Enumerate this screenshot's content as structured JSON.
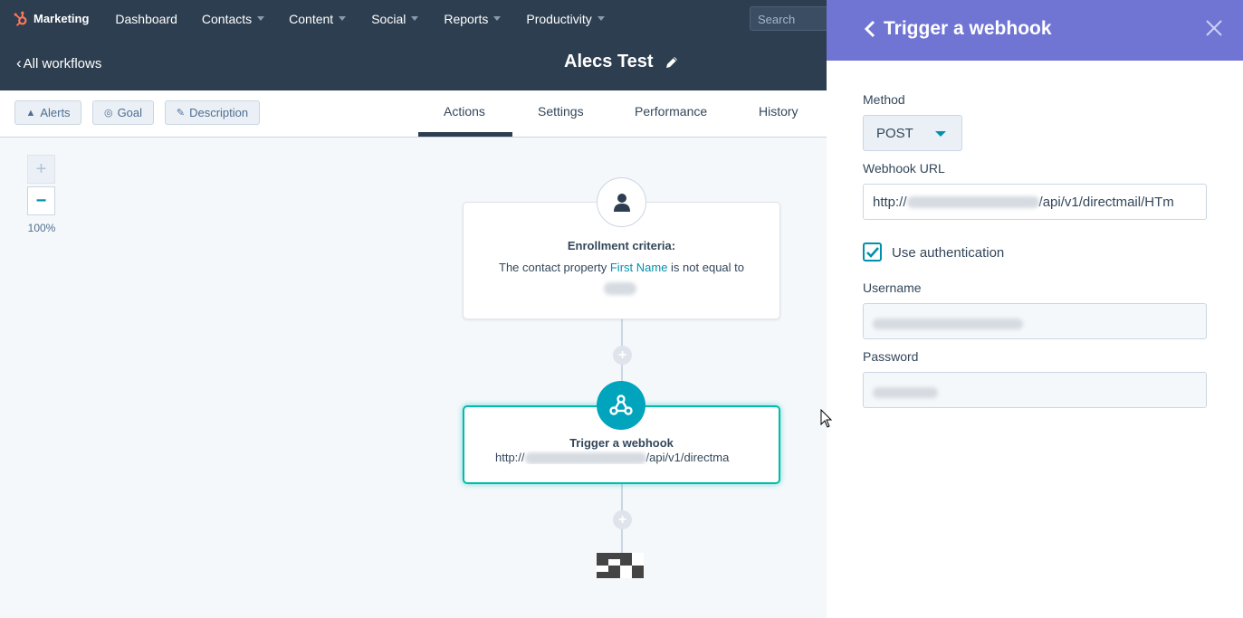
{
  "nav": {
    "brand": "Marketing",
    "items": [
      {
        "label": "Dashboard",
        "dropdown": false
      },
      {
        "label": "Contacts",
        "dropdown": true
      },
      {
        "label": "Content",
        "dropdown": true
      },
      {
        "label": "Social",
        "dropdown": true
      },
      {
        "label": "Reports",
        "dropdown": true
      },
      {
        "label": "Productivity",
        "dropdown": true
      }
    ],
    "search_placeholder": "Search"
  },
  "workflow": {
    "back_label": "All workflows",
    "title": "Alecs Test"
  },
  "toolbar": {
    "alerts_label": "Alerts",
    "goal_label": "Goal",
    "description_label": "Description",
    "tabs": [
      "Actions",
      "Settings",
      "Performance",
      "History"
    ],
    "active_tab": "Actions"
  },
  "zoom": {
    "plus": "+",
    "minus": "−",
    "level": "100%"
  },
  "canvas": {
    "enrollment": {
      "title": "Enrollment criteria:",
      "prefix": "The contact property",
      "property": "First Name",
      "suffix": "is not equal to"
    },
    "webhook_action": {
      "title": "Trigger a webhook",
      "url_prefix": "http://",
      "url_suffix": "/api/v1/directma"
    }
  },
  "panel": {
    "title": "Trigger a webhook",
    "method_label": "Method",
    "method_value": "POST",
    "url_label": "Webhook URL",
    "url_prefix": "http://",
    "url_suffix": "/api/v1/directmail/HTm",
    "use_auth_label": "Use authentication",
    "use_auth_checked": true,
    "username_label": "Username",
    "password_label": "Password"
  },
  "colors": {
    "nav_bg": "#2d3e50",
    "panel_header": "#7075d4",
    "accent_teal": "#00a4bd",
    "link": "#0091ae",
    "brand_orange": "#ff7a59"
  }
}
